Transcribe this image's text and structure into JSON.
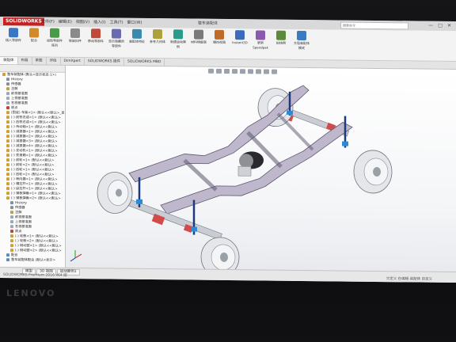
{
  "app": {
    "logo": "SOLIDWORKS",
    "menu": [
      "文件(F)",
      "编辑(E)",
      "视图(V)",
      "插入(I)",
      "工具(T)",
      "窗口(W)"
    ],
    "window_title": "整车装配体",
    "search_placeholder": "搜索命令",
    "window_controls": [
      "—",
      "□",
      "✕"
    ]
  },
  "ribbon": {
    "buttons": [
      {
        "label": "插入零部件",
        "color": "#3b78c4"
      },
      {
        "label": "配合",
        "color": "#d08a2a"
      },
      {
        "label": "线性零部件阵列",
        "color": "#4a9a4a"
      },
      {
        "label": "智能扣件",
        "color": "#8a8a8a"
      },
      {
        "label": "移动零部件",
        "color": "#c04a3a"
      },
      {
        "label": "显示隐藏的零部件",
        "color": "#6a6ab0"
      },
      {
        "label": "装配体特征",
        "color": "#3a8ab0"
      },
      {
        "label": "参考几何体",
        "color": "#b0a03a"
      },
      {
        "label": "新建运动算例",
        "color": "#2a9a8a"
      },
      {
        "label": "材料明细表",
        "color": "#7a7a7a"
      },
      {
        "label": "爆炸视图",
        "color": "#c06a2a"
      },
      {
        "label": "Instant3D",
        "color": "#3a6ac0"
      },
      {
        "label": "更新Speedpak",
        "color": "#8a5ab0"
      },
      {
        "label": "拍快照",
        "color": "#5a8a3a"
      },
      {
        "label": "大型装配体模式",
        "color": "#3a7ac0"
      }
    ]
  },
  "tabs": [
    "装配体",
    "布局",
    "草图",
    "评估",
    "DimXpert",
    "SOLIDWORKS 插件",
    "SOLIDWORKS MBD"
  ],
  "tree": {
    "nodes": [
      {
        "label": "整车装配体 (默认<显示状态-1>)",
        "color": "#d0a030",
        "indent": 0
      },
      {
        "label": "History",
        "color": "#8090a0",
        "indent": 1
      },
      {
        "label": "传感器",
        "color": "#8090a0",
        "indent": 1
      },
      {
        "label": "注解",
        "color": "#c0a040",
        "indent": 1
      },
      {
        "label": "前视基准面",
        "color": "#9aa8b8",
        "indent": 1
      },
      {
        "label": "上视基准面",
        "color": "#9aa8b8",
        "indent": 1
      },
      {
        "label": "右视基准面",
        "color": "#9aa8b8",
        "indent": 1
      },
      {
        "label": "原点",
        "color": "#c04040",
        "indent": 1
      },
      {
        "label": "(固定) 车架<1> (默认<<默认>_显",
        "color": "#d0a030",
        "indent": 1
      },
      {
        "label": "(-) 前桥总成<1> (默认<<默认>",
        "color": "#d0a030",
        "indent": 1
      },
      {
        "label": "(-) 后桥总成<1> (默认<<默认>",
        "color": "#d0a030",
        "indent": 1
      },
      {
        "label": "(-) 传动轴<1> (默认<<默认>",
        "color": "#d0a030",
        "indent": 1
      },
      {
        "label": "(-) 减振器<1> (默认<<默认>",
        "color": "#d0a030",
        "indent": 1
      },
      {
        "label": "(-) 减振器<2> (默认<<默认>",
        "color": "#d0a030",
        "indent": 1
      },
      {
        "label": "(-) 减振器<3> (默认<<默认>",
        "color": "#d0a030",
        "indent": 1
      },
      {
        "label": "(-) 减振器<4> (默认<<默认>",
        "color": "#d0a030",
        "indent": 1
      },
      {
        "label": "(-) 发动机<1> (默认<<默认>",
        "color": "#d0a030",
        "indent": 1
      },
      {
        "label": "(-) 变速箱<1> (默认<<默认>",
        "color": "#d0a030",
        "indent": 1
      },
      {
        "label": "(-) 前轮<1> (默认<<默认>",
        "color": "#d0a030",
        "indent": 1
      },
      {
        "label": "(-) 前轮<2> (默认<<默认>",
        "color": "#d0a030",
        "indent": 1
      },
      {
        "label": "(-) 后轮<1> (默认<<默认>",
        "color": "#d0a030",
        "indent": 1
      },
      {
        "label": "(-) 后轮<2> (默认<<默认>",
        "color": "#d0a030",
        "indent": 1
      },
      {
        "label": "(-) 转向器<1> (默认<<默认>",
        "color": "#d0a030",
        "indent": 1
      },
      {
        "label": "(-) 横拉杆<1> (默认<<默认>",
        "color": "#d0a030",
        "indent": 1
      },
      {
        "label": "(-) 纵拉杆<1> (默认<<默认>",
        "color": "#d0a030",
        "indent": 1
      },
      {
        "label": "(-) 钢板弹簧<1> (默认<<默认>",
        "color": "#d0a030",
        "indent": 1
      },
      {
        "label": "(-) 钢板弹簧<2> (默认<<默认>",
        "color": "#d0a030",
        "indent": 1
      },
      {
        "label": "History",
        "color": "#8090a0",
        "indent": 2
      },
      {
        "label": "传感器",
        "color": "#8090a0",
        "indent": 2
      },
      {
        "label": "注解",
        "color": "#c0a040",
        "indent": 2
      },
      {
        "label": "前视基准面",
        "color": "#9aa8b8",
        "indent": 2
      },
      {
        "label": "上视基准面",
        "color": "#9aa8b8",
        "indent": 2
      },
      {
        "label": "右视基准面",
        "color": "#9aa8b8",
        "indent": 2
      },
      {
        "label": "原点",
        "color": "#c04040",
        "indent": 2
      },
      {
        "label": "(-) 轮毂<1> (默认<<默认>",
        "color": "#d0a030",
        "indent": 2
      },
      {
        "label": "(-) 轮毂<2> (默认<<默认>",
        "color": "#d0a030",
        "indent": 2
      },
      {
        "label": "(-) 制动鼓<1> (默认<<默认>",
        "color": "#d0a030",
        "indent": 2
      },
      {
        "label": "(-) 制动鼓<2> (默认<<默认>",
        "color": "#d0a030",
        "indent": 2
      },
      {
        "label": "配合",
        "color": "#5a8ac0",
        "indent": 1
      },
      {
        "label": "整车装配体配合 (默认<显示>",
        "color": "#5a8ac0",
        "indent": 1
      }
    ]
  },
  "status_bar": {
    "tabs": [
      "模型",
      "3D 视图",
      "运动算例1"
    ],
    "left_text": "SOLIDWORKS Premium 2016 x64 版",
    "right_text": "欠定义   在编辑 装配体   自定义"
  },
  "laptop_brand": "LENOVO"
}
